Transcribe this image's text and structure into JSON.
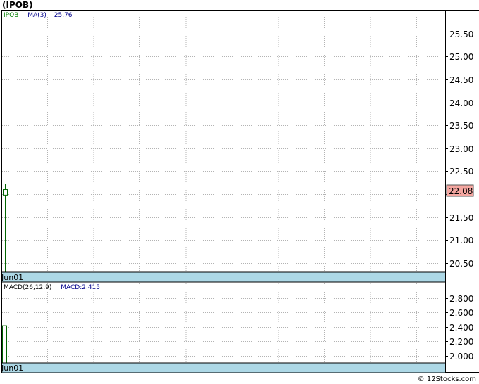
{
  "title": "(IPOB)",
  "footer": "© 12Stocks.com",
  "chart_data": [
    {
      "type": "candlestick",
      "legend": {
        "symbol": "IPOB",
        "ma_label": "MA(3)",
        "ma_value": "25.76",
        "symbol_color": "#008000",
        "ma_color": "#00008b"
      },
      "ylim": [
        20.3,
        26.0
      ],
      "ytick_values": [
        20.5,
        21.0,
        21.5,
        22.0,
        22.5,
        23.0,
        23.5,
        24.0,
        24.5,
        25.0,
        25.5
      ],
      "ytick_labels": [
        "20.50",
        "21.00",
        "21.50",
        "",
        "22.50",
        "23.00",
        "23.50",
        "24.00",
        "24.50",
        "25.00",
        "25.50"
      ],
      "last_price": {
        "value": 22.08,
        "label": "22.08",
        "color": "#f4a6a0"
      },
      "candles": [
        {
          "date": "Jun01",
          "open": 21.98,
          "close": 22.1,
          "high": 22.22,
          "low": 20.3
        }
      ],
      "x_labels": [
        "Jun01"
      ],
      "grid": true,
      "colors": {
        "up": "#006400",
        "band": "#add8e6"
      }
    },
    {
      "type": "bar",
      "legend": {
        "label": "MACD(26,12,9)",
        "macd_label": "MACD:2.415",
        "label_color": "#000000",
        "macd_color": "#00008b"
      },
      "ylim": [
        1.9,
        3.0
      ],
      "ytick_values": [
        2.0,
        2.2,
        2.4,
        2.6,
        2.8
      ],
      "ytick_labels": [
        "2.000",
        "2.200",
        "2.400",
        "2.600",
        "2.800"
      ],
      "categories": [
        "Jun01"
      ],
      "values": [
        2.415
      ],
      "x_labels": [
        "Jun01"
      ],
      "grid": true,
      "colors": {
        "bar": "#006400",
        "band": "#add8e6"
      }
    }
  ]
}
